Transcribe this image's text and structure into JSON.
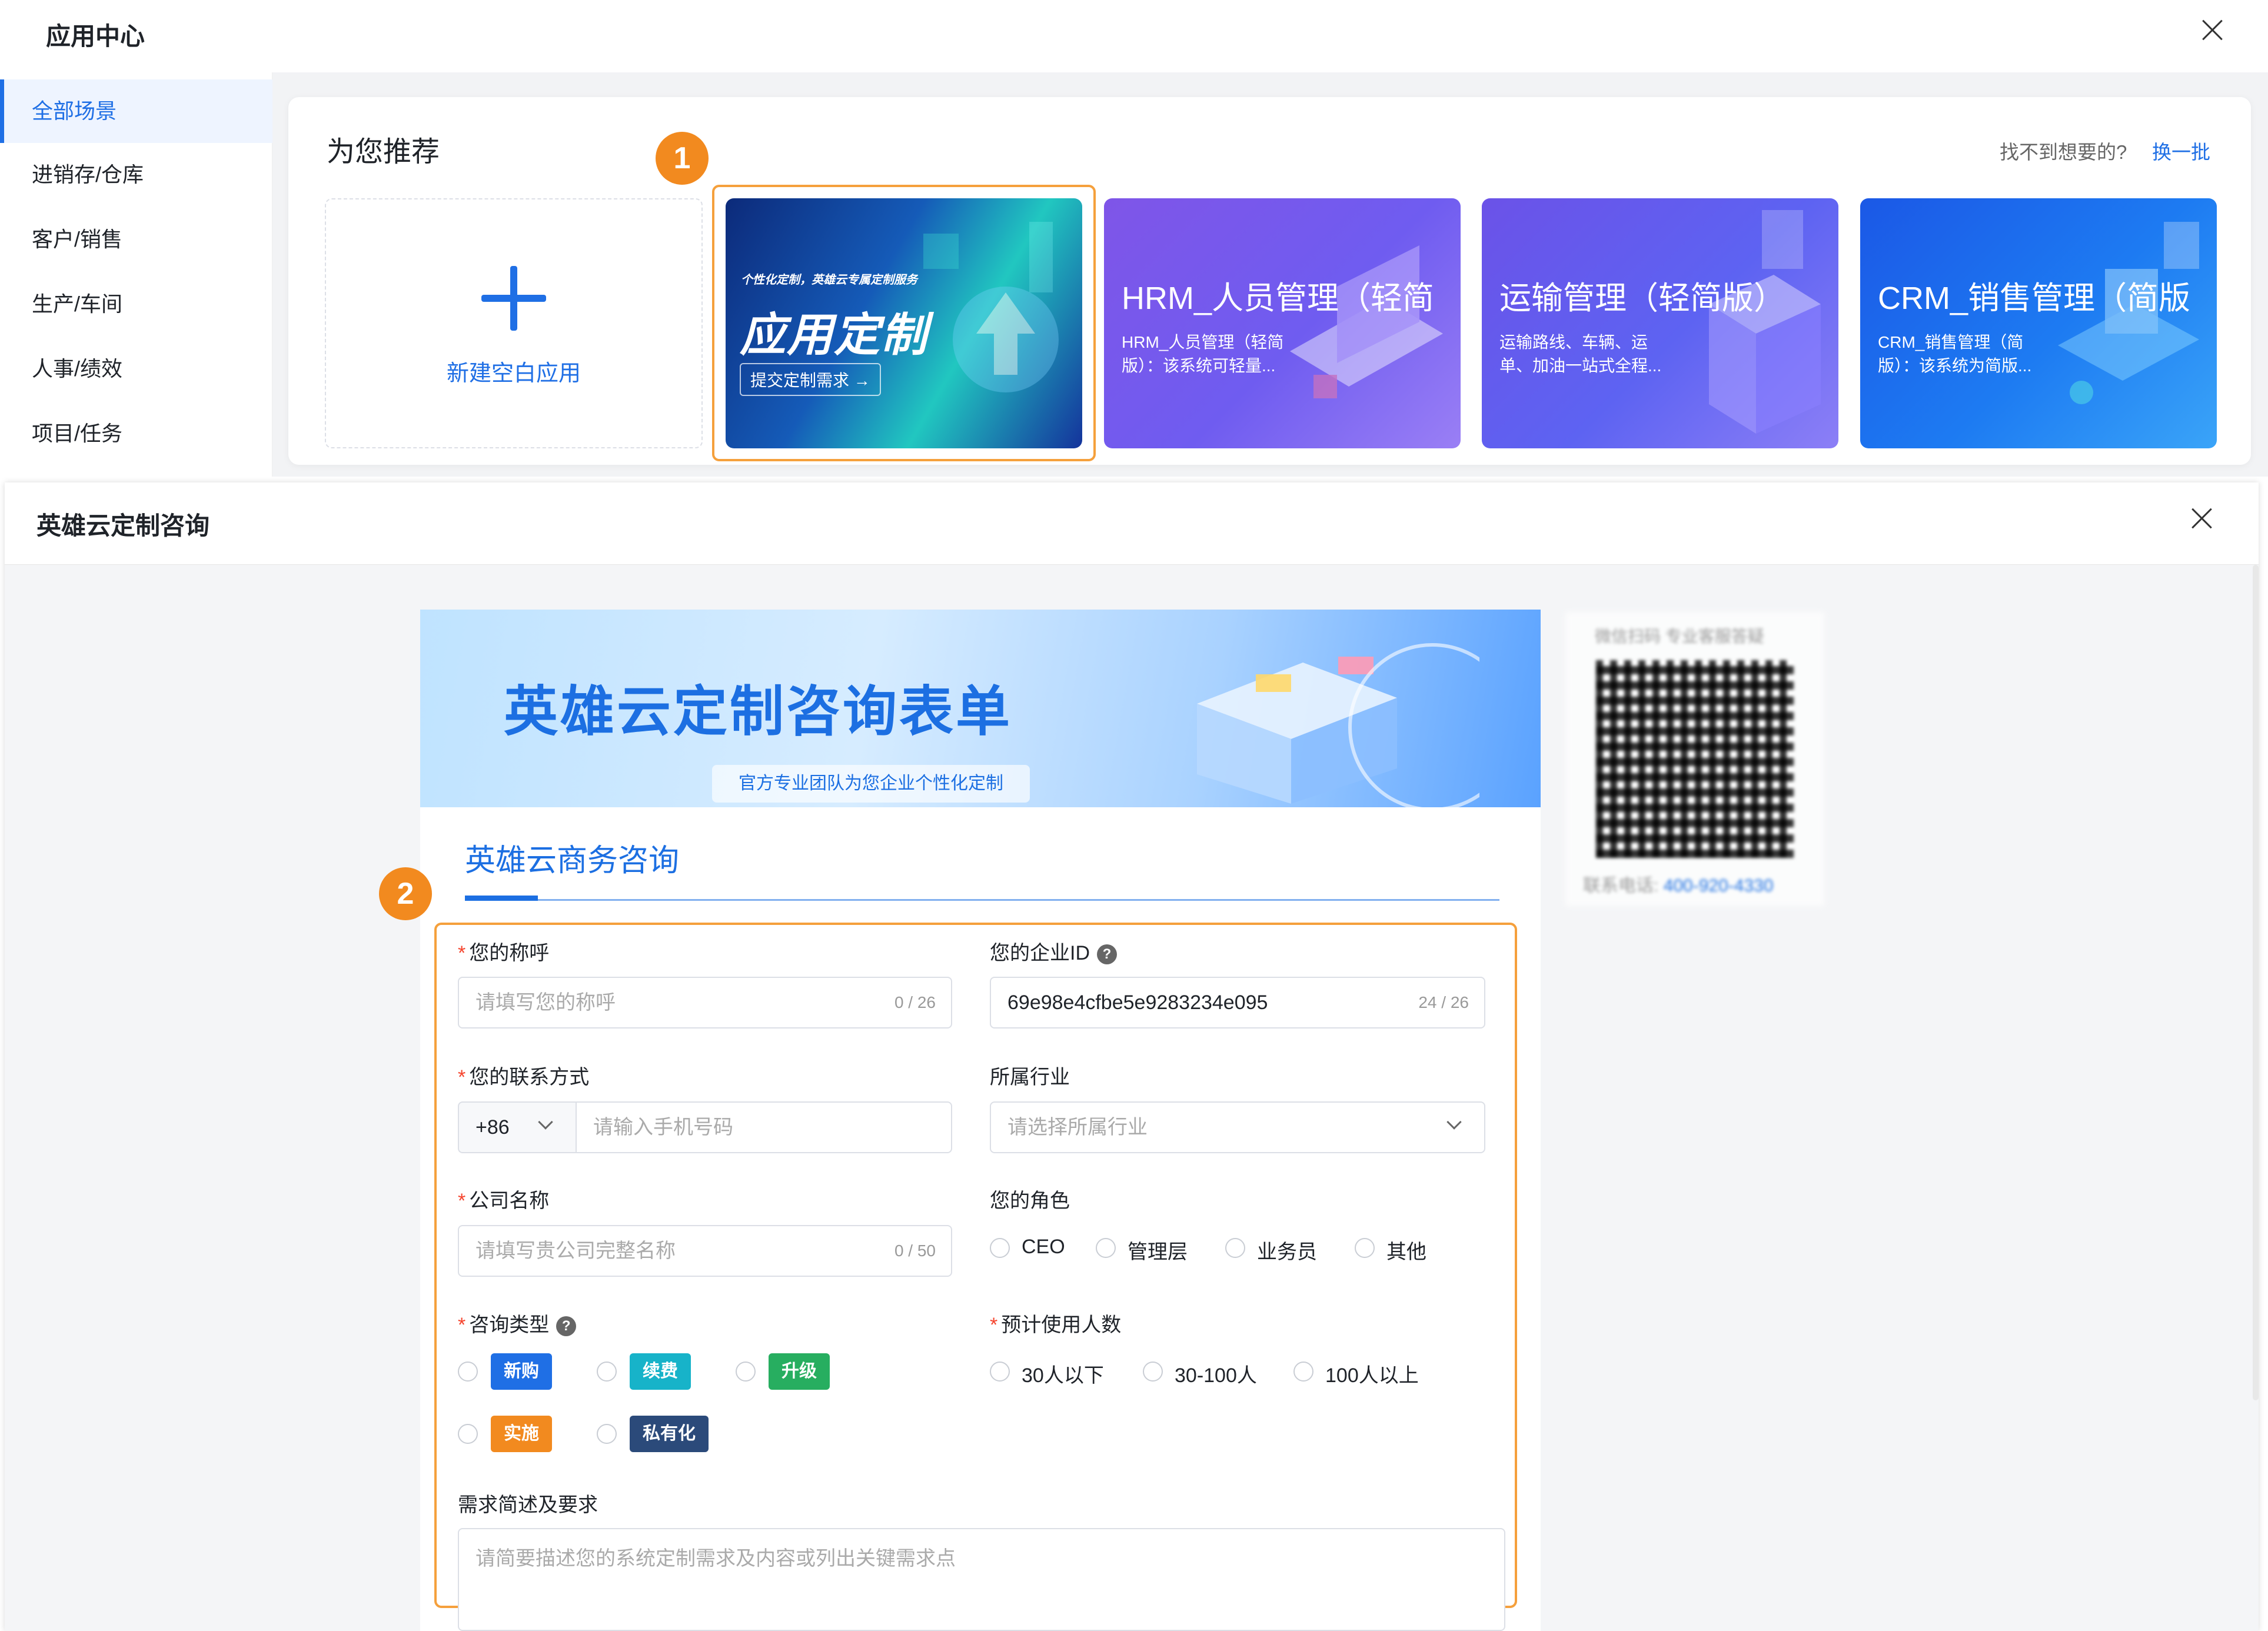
{
  "app_center": {
    "title": "应用中心",
    "sidebar": [
      {
        "label": "全部场景",
        "active": true
      },
      {
        "label": "进销存/仓库"
      },
      {
        "label": "客户/销售"
      },
      {
        "label": "生产/车间"
      },
      {
        "label": "人事/绩效"
      },
      {
        "label": "项目/任务"
      }
    ],
    "recommend_title": "为您推荐",
    "hint": "找不到想要的?",
    "refresh": "换一批",
    "new_app": "新建空白应用",
    "custom_card": {
      "small_text": "个性化定制，英雄云专属定制服务",
      "big_text": "应用定制",
      "button": "提交定制需求 →"
    },
    "templates": [
      {
        "name": "HRM_人员管理（轻简",
        "desc": "HRM_人员管理（轻简版）：该系统可轻量..."
      },
      {
        "name": "运输管理（轻简版）",
        "desc": "运输路线、车辆、运单、加油一站式全程..."
      },
      {
        "name": "CRM_销售管理（简版",
        "desc": "CRM_销售管理（简版）：该系统为简版..."
      }
    ],
    "badge": "1"
  },
  "consult": {
    "title": "英雄云定制咨询",
    "banner_title": "英雄云定制咨询表单",
    "banner_sub": "官方专业团队为您企业个性化定制",
    "qr_caption": "微信扫码 专业客服答疑",
    "qr_phone_label": "联系电话:",
    "qr_phone": "400-920-4330",
    "section_title": "英雄云商务咨询",
    "badge": "2",
    "form": {
      "name_label": "您的称呼",
      "name_placeholder": "请填写您的称呼",
      "name_counter": "0 / 26",
      "enterprise_label": "您的企业ID",
      "enterprise_value": "69e98e4cfbe5e9283234e095",
      "enterprise_counter": "24 / 26",
      "contact_label": "您的联系方式",
      "phone_prefix": "+86",
      "phone_placeholder": "请输入手机号码",
      "industry_label": "所属行业",
      "industry_placeholder": "请选择所属行业",
      "company_label": "公司名称",
      "company_placeholder": "请填写贵公司完整名称",
      "company_counter": "0 / 50",
      "role_label": "您的角色",
      "roles": [
        "CEO",
        "管理层",
        "业务员",
        "其他"
      ],
      "consult_type_label": "咨询类型",
      "consult_types": [
        "新购",
        "续费",
        "升级",
        "实施",
        "私有化"
      ],
      "users_label": "预计使用人数",
      "user_ranges": [
        "30人以下",
        "30-100人",
        "100人以上"
      ],
      "desc_label": "需求简述及要求",
      "desc_placeholder": "请简要描述您的系统定制需求及内容或列出关键需求点"
    }
  }
}
